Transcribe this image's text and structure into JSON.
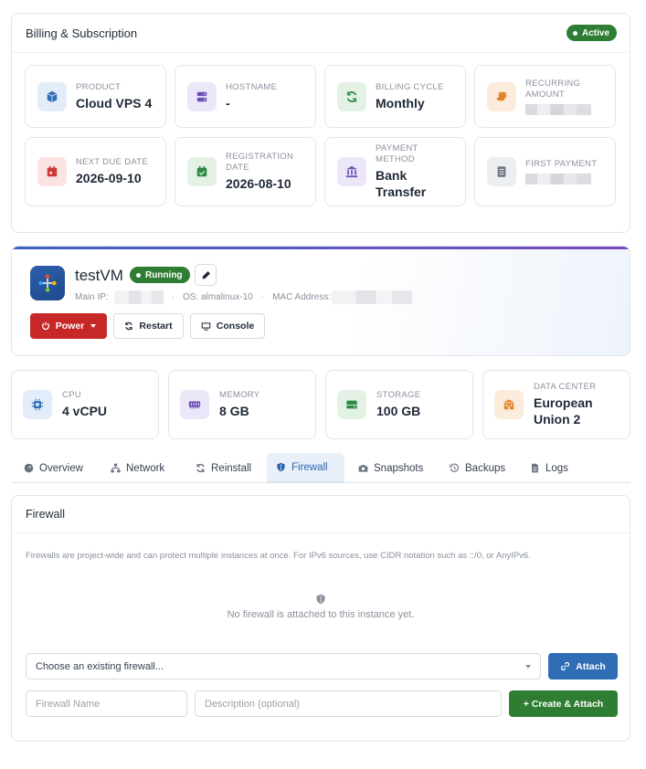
{
  "billing": {
    "title": "Billing & Subscription",
    "status": "Active",
    "tiles": [
      {
        "label": "PRODUCT",
        "value": "Cloud VPS 4",
        "icon": "cube-icon",
        "color": "blue"
      },
      {
        "label": "HOSTNAME",
        "value": "-",
        "icon": "server-icon",
        "color": "purple"
      },
      {
        "label": "BILLING CYCLE",
        "value": "Monthly",
        "icon": "refresh-icon",
        "color": "green"
      },
      {
        "label": "RECURRING AMOUNT",
        "value": "",
        "icon": "coins-icon",
        "color": "orange"
      },
      {
        "label": "NEXT DUE DATE",
        "value": "2026-09-10",
        "icon": "calendar-icon",
        "color": "red"
      },
      {
        "label": "REGISTRATION DATE",
        "value": "2026-08-10",
        "icon": "calendar-check-icon",
        "color": "green"
      },
      {
        "label": "PAYMENT METHOD",
        "value": "Bank Transfer",
        "icon": "bank-icon",
        "color": "purple"
      },
      {
        "label": "FIRST PAYMENT",
        "value": "",
        "icon": "receipt-icon",
        "color": "gray"
      }
    ]
  },
  "vm": {
    "name": "testVM",
    "status": "Running",
    "main_ip_label": "Main IP:",
    "os_label": "OS: almalinux-10",
    "mac_label": "MAC Address:",
    "separator": "·",
    "actions": {
      "power": "Power",
      "restart": "Restart",
      "console": "Console"
    }
  },
  "resources": [
    {
      "label": "CPU",
      "value": "4 vCPU",
      "icon": "cpu-icon",
      "color": "blue"
    },
    {
      "label": "MEMORY",
      "value": "8 GB",
      "icon": "memory-icon",
      "color": "purple"
    },
    {
      "label": "STORAGE",
      "value": "100 GB",
      "icon": "storage-icon",
      "color": "green"
    },
    {
      "label": "DATA CENTER",
      "value": "European Union 2",
      "icon": "building-icon",
      "color": "orange"
    }
  ],
  "tabs": [
    {
      "label": "Overview",
      "icon": "gauge-icon"
    },
    {
      "label": "Network",
      "icon": "network-icon"
    },
    {
      "label": "Reinstall",
      "icon": "refresh-icon"
    },
    {
      "label": "Firewall",
      "icon": "shield-icon",
      "active": true
    },
    {
      "label": "Snapshots",
      "icon": "camera-icon"
    },
    {
      "label": "Backups",
      "icon": "history-icon"
    },
    {
      "label": "Logs",
      "icon": "file-icon"
    }
  ],
  "firewall": {
    "title": "Firewall",
    "note": "Firewalls are project-wide and can protect multiple instances at once. For IPv6 sources, use CIDR notation such as ::/0, or AnyIPv6.",
    "empty": "No firewall is attached to this instance yet.",
    "select_placeholder": "Choose an existing firewall...",
    "attach": "Attach",
    "name_placeholder": "Firewall Name",
    "desc_placeholder": "Description (optional)",
    "create": "+ Create & Attach"
  }
}
